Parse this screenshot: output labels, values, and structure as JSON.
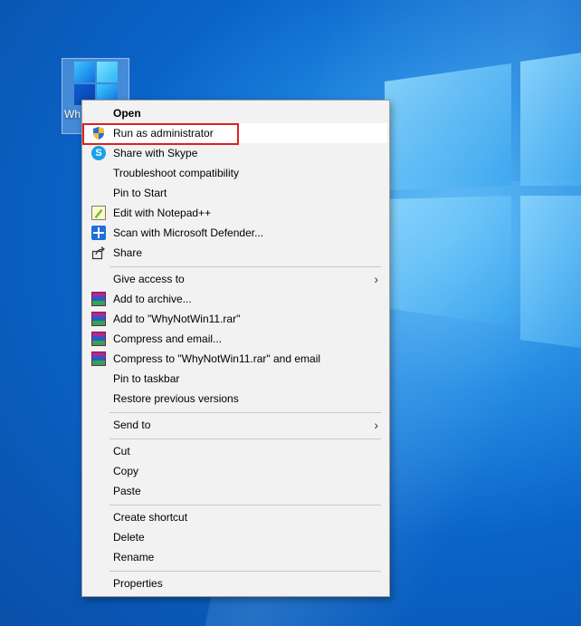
{
  "desktop_icon": {
    "label": "Wh"
  },
  "menu": {
    "items": [
      {
        "label": "Open",
        "bold": true
      },
      {
        "label": "Run as administrator",
        "icon": "uac-shield-icon"
      },
      {
        "label": "Share with Skype",
        "icon": "skype-icon"
      },
      {
        "label": "Troubleshoot compatibility"
      },
      {
        "label": "Pin to Start"
      },
      {
        "label": "Edit with Notepad++",
        "icon": "notepadpp-icon"
      },
      {
        "label": "Scan with Microsoft Defender...",
        "icon": "defender-icon"
      },
      {
        "label": "Share",
        "icon": "share-icon"
      },
      {
        "label": "Give access to",
        "submenu": true
      },
      {
        "label": "Add to archive...",
        "icon": "winrar-icon"
      },
      {
        "label": "Add to \"WhyNotWin11.rar\"",
        "icon": "winrar-icon"
      },
      {
        "label": "Compress and email...",
        "icon": "winrar-icon"
      },
      {
        "label": "Compress to \"WhyNotWin11.rar\" and email",
        "icon": "winrar-icon"
      },
      {
        "label": "Pin to taskbar"
      },
      {
        "label": "Restore previous versions"
      },
      {
        "label": "Send to",
        "submenu": true
      },
      {
        "label": "Cut"
      },
      {
        "label": "Copy"
      },
      {
        "label": "Paste"
      },
      {
        "label": "Create shortcut"
      },
      {
        "label": "Delete"
      },
      {
        "label": "Rename"
      },
      {
        "label": "Properties"
      }
    ],
    "submenu_arrow": "›"
  },
  "colors": {
    "highlight_outline": "#e02020",
    "menu_bg": "#f2f2f2"
  }
}
